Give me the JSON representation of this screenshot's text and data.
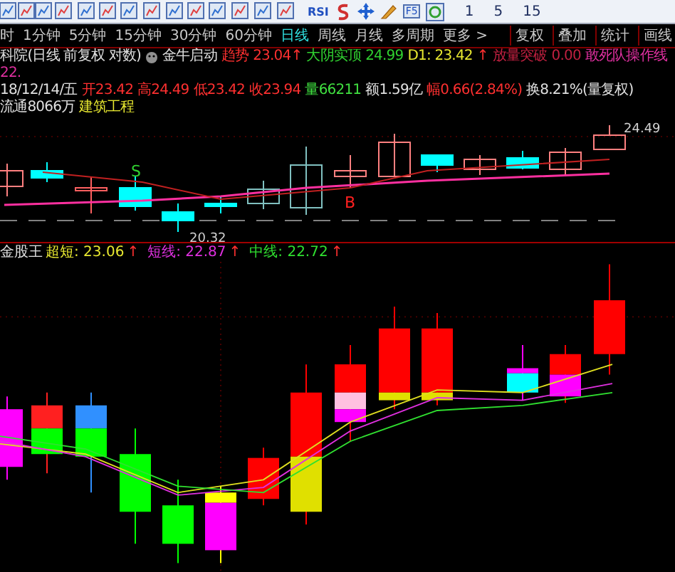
{
  "toolbar": {
    "labels": [
      "RSI",
      "F5"
    ],
    "numbers": [
      "1",
      "5",
      "15"
    ]
  },
  "period_tabs": [
    {
      "label": "时",
      "selected": false
    },
    {
      "label": "1分钟",
      "selected": false
    },
    {
      "label": "5分钟",
      "selected": false
    },
    {
      "label": "15分钟",
      "selected": false
    },
    {
      "label": "30分钟",
      "selected": false
    },
    {
      "label": "60分钟",
      "selected": false
    },
    {
      "label": "日线",
      "selected": true
    },
    {
      "label": "周线",
      "selected": false
    },
    {
      "label": "月线",
      "selected": false
    },
    {
      "label": "多周期",
      "selected": false
    },
    {
      "label": "更多 >",
      "selected": false
    }
  ],
  "right_tabs": [
    "复权",
    "叠加",
    "统计",
    "画线"
  ],
  "info_line_1": [
    {
      "text": "科院(日线 前复权 对数)",
      "color": "#e0e0e0"
    },
    {
      "text": "金牛启动",
      "color": "#e0e0e0",
      "icon": true
    },
    {
      "text": "趋势",
      "color": "#ff3030"
    },
    {
      "text": "23.04↑",
      "color": "#ff3030"
    },
    {
      "text": "大阴实顶",
      "color": "#30d030"
    },
    {
      "text": "24.99",
      "color": "#30d030"
    },
    {
      "text": "D1: 23.42",
      "color": "#e8e830"
    },
    {
      "text": "↑",
      "color": "#ff3030"
    },
    {
      "text": "放量突破",
      "color": "#c02040"
    },
    {
      "text": "0.00",
      "color": "#c02040"
    },
    {
      "text": "敢死队操作线",
      "color": "#e030a0"
    },
    {
      "text": "22.",
      "color": "#e030a0"
    }
  ],
  "info_line_2": [
    {
      "text": "18/12/14/五",
      "color": "#e0e0e0"
    },
    {
      "text": "开23.42",
      "color": "#ff3030"
    },
    {
      "text": "高24.49",
      "color": "#ff3030"
    },
    {
      "text": "低23.42",
      "color": "#ff3030"
    },
    {
      "text": "收23.94",
      "color": "#ff3030"
    },
    {
      "text": "量66211",
      "color": "#40e040"
    },
    {
      "text": "额1.59亿",
      "color": "#e0e0e0"
    },
    {
      "text": "幅0.66(2.84%)",
      "color": "#ff3030"
    },
    {
      "text": "换8.21%(量复权)",
      "color": "#e0e0e0"
    },
    {
      "text": "流通8066万",
      "color": "#e0e0e0"
    },
    {
      "text": "建筑工程",
      "color": "#e8e830"
    }
  ],
  "price_chart": {
    "sell_mark": "S",
    "buy_mark": "B",
    "low_label": "20.32",
    "high_label": "24.49"
  },
  "indicator": {
    "name": "金股王",
    "lines": [
      {
        "label": "超短: 23.06",
        "trend": "↑",
        "color": "#e8e830"
      },
      {
        "label": "短线: 22.87",
        "trend": "↑",
        "color": "#e030e0"
      },
      {
        "label": "中线: 22.72",
        "trend": "↑",
        "color": "#30e030"
      }
    ]
  }
}
